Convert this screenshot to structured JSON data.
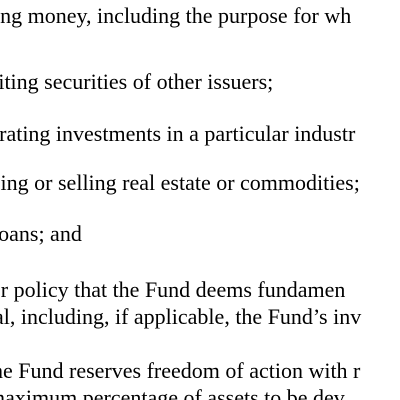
{
  "document": {
    "lines": [
      "ing money, including the purpose for wh",
      "riting securities of other issuers;",
      "trating investments in a particular industr",
      "sing or selling real estate or commodities;",
      " loans; and",
      "er policy that the Fund deems fundamen",
      "al, including, if applicable, the Fund’s inv",
      "he Fund reserves freedom of action with r",
      "maximum percentage of assets to be dev"
    ]
  }
}
